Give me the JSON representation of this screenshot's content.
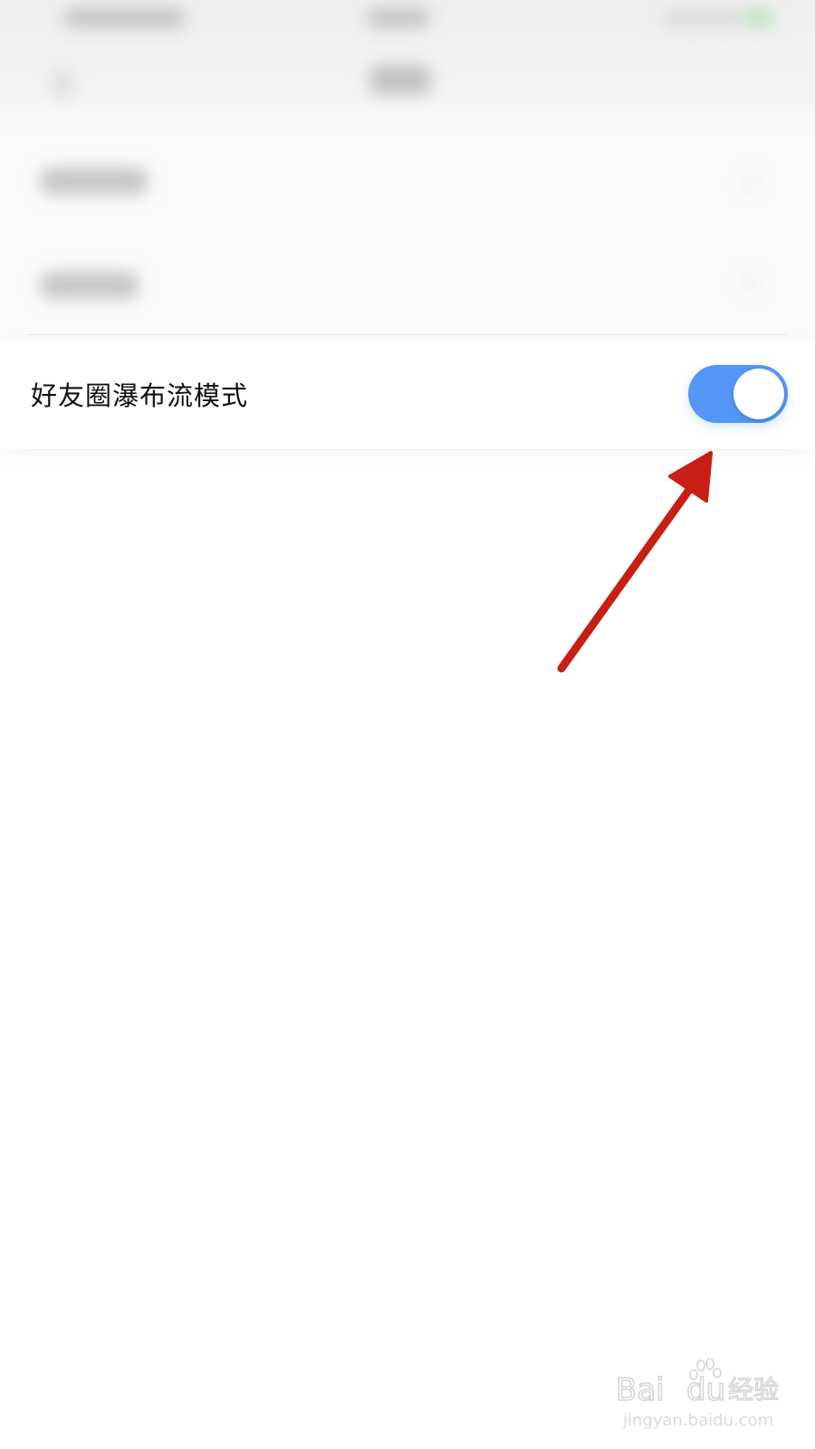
{
  "setting": {
    "label": "好友圈瀑布流模式",
    "toggle_on": true
  },
  "colors": {
    "toggle_active": "#5496f5",
    "arrow": "#c81e14"
  },
  "watermark": {
    "logo_text": "Baidu经验",
    "url": "jingyan.baidu.com"
  }
}
